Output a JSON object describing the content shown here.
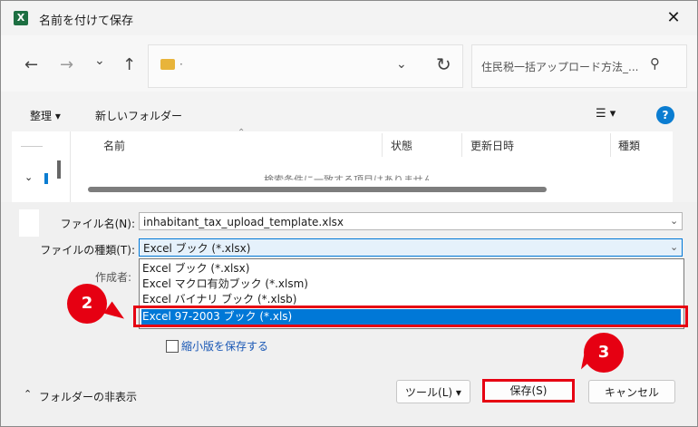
{
  "window": {
    "title": "名前を付けて保存",
    "app_icon": "X",
    "close_glyph": "✕"
  },
  "nav": {
    "back": "←",
    "forward": "→",
    "recent": "⌄",
    "up": "↑"
  },
  "address": {
    "path": "·",
    "chevron": "⌄",
    "refresh": "↻"
  },
  "search": {
    "placeholder": "住民税一括アップロード方法_...",
    "icon": "⚲"
  },
  "toolbar": {
    "organize": "整理 ▾",
    "new_folder": "新しいフォルダー",
    "view": "☰ ▾",
    "help": "?"
  },
  "columns": {
    "name": "名前",
    "status": "状態",
    "modified": "更新日時",
    "type": "種類"
  },
  "empty_message": "検索条件に一致する項目はありません。",
  "form": {
    "filename_label": "ファイル名(N):",
    "filename_value": "inhabitant_tax_upload_template.xlsx",
    "filetype_label": "ファイルの種類(T):",
    "filetype_value": "Excel ブック (*.xlsx)",
    "author_label": "作成者:",
    "options": [
      "Excel ブック (*.xlsx)",
      "Excel マクロ有効ブック (*.xlsm)",
      "Excel バイナリ ブック (*.xlsb)",
      "Excel 97-2003 ブック (*.xls)"
    ],
    "selected_option_index": 3,
    "thumbnail_label": "縮小版を保存する"
  },
  "footer": {
    "hide_folders": "フォルダーの非表示",
    "tools": "ツール(L)",
    "save": "保存(S)",
    "cancel": "キャンセル"
  },
  "annotations": {
    "step2": "2",
    "step3": "3"
  },
  "colors": {
    "accent_red": "#e60012",
    "selection_blue": "#0078d7",
    "excel_green": "#1d6f42"
  }
}
